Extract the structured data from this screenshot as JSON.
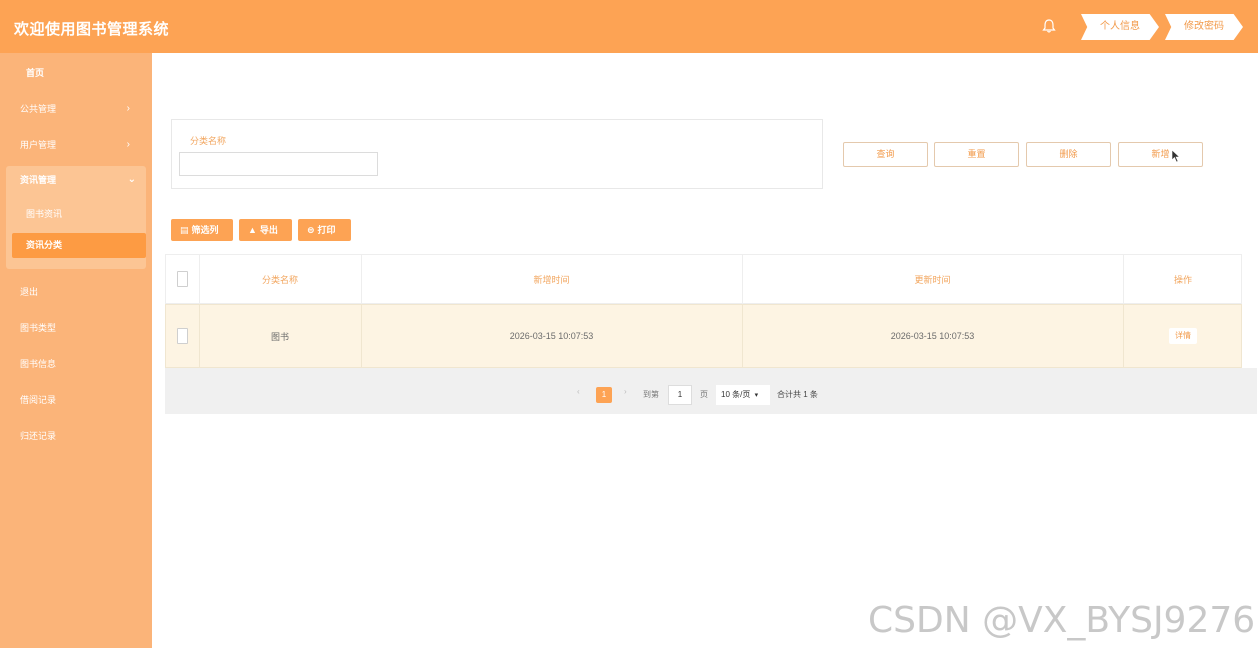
{
  "header": {
    "title": "欢迎使用图书管理系统",
    "profile_label": "个人信息",
    "password_label": "修改密码"
  },
  "sidebar": {
    "home": "首页",
    "public_manage": "公共管理",
    "user_manage": "用户管理",
    "news_manage": "资讯管理",
    "book_news": "图书资讯",
    "news_category": "资讯分类",
    "logout": "退出",
    "book_type": "图书类型",
    "book_info": "图书信息",
    "borrow_record": "借阅记录",
    "return_record": "归还记录"
  },
  "search": {
    "label": "分类名称",
    "value": ""
  },
  "actions": {
    "query": "查询",
    "reset": "重置",
    "delete": "删除",
    "add": "新增"
  },
  "tools": {
    "filter": "筛选列",
    "export": "导出",
    "print": "打印"
  },
  "table": {
    "headers": [
      "分类名称",
      "新增时间",
      "更新时间",
      "操作"
    ],
    "rows": [
      {
        "name": "图书",
        "created": "2026-03-15 10:07:53",
        "updated": "2026-03-15 10:07:53",
        "action": "详情"
      }
    ]
  },
  "pagination": {
    "current_page": "1",
    "goto_label": "到第",
    "goto_value": "1",
    "page_unit": "页",
    "page_size": "10 条/页",
    "total": "合计共 1 条"
  },
  "watermark": "CSDN @VX_BYSJ9276",
  "colors": {
    "primary": "#fda354",
    "sidebar": "#fbb479",
    "row_highlight": "#fdf4e3"
  }
}
